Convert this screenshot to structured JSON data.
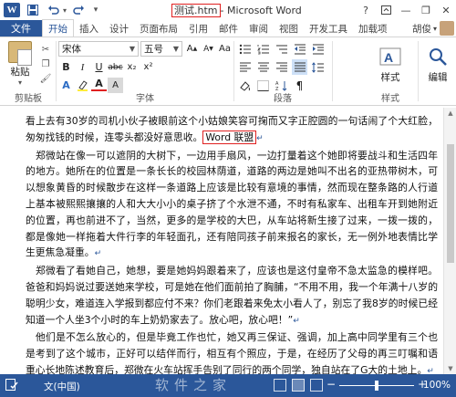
{
  "window": {
    "app_icon": "W",
    "filename": "测试.htm",
    "app_name": " - Microsoft Word",
    "help": "?",
    "minimize": "—",
    "maximize": "❐",
    "close": "✕"
  },
  "quick_access": {
    "save_icon": "save-icon",
    "undo_icon": "undo-icon",
    "redo_icon": "redo-icon",
    "customize_icon": "customize-icon"
  },
  "tabs": {
    "file": "文件",
    "items": [
      "开始",
      "插入",
      "设计",
      "页面布局",
      "引用",
      "邮件",
      "审阅",
      "视图",
      "开发工具",
      "加载项"
    ],
    "active": 0
  },
  "user": {
    "name": "胡俊",
    "dropdown": "▾"
  },
  "ribbon": {
    "clipboard": {
      "paste": "粘贴",
      "label": "剪贴板"
    },
    "font": {
      "name": "宋体",
      "size": "五号",
      "label": "字体",
      "buttons": [
        "B",
        "I",
        "U",
        "abc",
        "x₂",
        "x²",
        "A",
        "Aa",
        "A",
        "A"
      ]
    },
    "paragraph": {
      "label": "段落"
    },
    "styles": {
      "button": "样式",
      "label": "样式"
    },
    "editing": {
      "button": "编辑"
    }
  },
  "document": {
    "paragraphs": [
      {
        "text": "看上去有30岁的司机小伙子被眼前这个小姑娘笑容可掬而又字正腔圆的一句话闹了个大红脸，匆匆找钱的时候，连零头都没好意思收。",
        "highlight": "Word 联盟"
      },
      {
        "text": "　郑微站在像一可以遮阴的大树下，一边用手扇风，一边打量着这个她即将要战斗和生活四年的地方。她所在的位置是一条长长的校园林荫道，道路的两边是她叫不出名的亚热带树木，可以想象黄昏的时候散步在这样一条道路上应该是比较有意境的事情，然而现在整条路的人行道上基本被熙熙攘攘的人和大大小小的桌子挤了个水泄不通，不时有私家车、出租车开到她附近的位置，再也前进不了，当然，更多的是学校的大巴，从车站将新生接了过来，一拨一拨的，都是像她一样拖着大件行李的年轻面孔，还有陪同孩子前来报名的家长，无一例外地表情比学生更焦急凝重。"
      },
      {
        "text": "　郑微看了看她自己，她想，要是她妈妈跟着来了，应该也是这付皇帝不急太监急的模样吧。爸爸和妈妈说过要送她来学校，可是她在他们面前拍了胸脯，“不用不用，我一个年满十八岁的聪明少女，难道连入学报到都应付不来？你们老跟着来免太小看人了，别忘了我8岁的时候已经知道一个人坐3个小时的车上奶奶家去了。放心吧，放心吧！”"
      },
      {
        "text": "　他们是不怎么放心的，但是毕竟工作也忙，她又再三保证、强调，加上高中同学里有三个也是考到了这个城市，正好可以结伴而行，相互有个照应，于是，在经历了父母的再三叮嘱和语重心长地陈述教育后，郑微在火车站挥手告别了同行的两个同学，独自站在了G大的土地上。"
      }
    ]
  },
  "status": {
    "language": "文(中国)",
    "watermark": "软件之家",
    "zoom_minus": "−",
    "zoom_plus": "+",
    "zoom_level": "100%",
    "zoom_fraction": 0.5
  },
  "colors": {
    "accent": "#2b579a",
    "highlight_box": "#e02020"
  }
}
